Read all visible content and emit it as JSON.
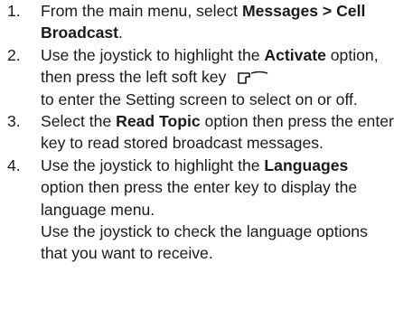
{
  "steps": [
    {
      "number": "1.",
      "text1": "From the main menu, select ",
      "bold1": "Messages > Cell Broadcast",
      "text2": "."
    },
    {
      "number": "2.",
      "text1": "Use the joystick to highlight the ",
      "bold1": "Activate",
      "text2": " option, then press the left soft key",
      "icon": "left-soft-key-icon",
      "text3": "to enter the Setting screen to select on or off."
    },
    {
      "number": "3.",
      "text1": "Select the ",
      "bold1": "Read Topic",
      "text2": " option then press the enter key to read stored broadcast messages."
    },
    {
      "number": "4.",
      "text1": "Use the joystick to highlight the ",
      "bold1": "Languages",
      "text2": " option then press the enter key to display the language menu.",
      "text3": "Use the joystick to check the language options that you want to receive."
    }
  ]
}
